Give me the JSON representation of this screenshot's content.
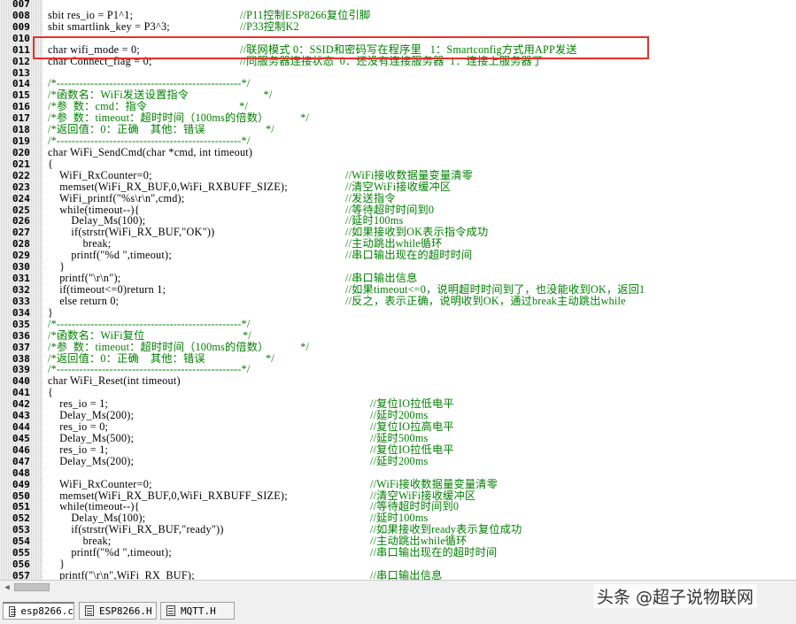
{
  "editor": {
    "lines": [
      {
        "n": "007",
        "code": "",
        "comment": ""
      },
      {
        "n": "008",
        "code": "sbit res_io = P1^1;",
        "comment": "//P11控制ESP8266复位引脚"
      },
      {
        "n": "009",
        "code": "sbit smartlink_key = P3^3;",
        "comment": "//P33控制K2"
      },
      {
        "n": "010",
        "code": "",
        "comment": ""
      },
      {
        "n": "011",
        "code": "char wifi_mode = 0;",
        "comment": "//联网模式 0：SSID和密码写在程序里   1：Smartconfig方式用APP发送"
      },
      {
        "n": "012",
        "code": "char Connect_flag = 0;",
        "comment": "//同服务器连接状态  0：还没有连接服务器  1：连接上服务器了"
      },
      {
        "n": "013",
        "code": "",
        "comment": ""
      },
      {
        "n": "014",
        "code": "",
        "comment": "/*-------------------------------------------------*/"
      },
      {
        "n": "015",
        "code": "",
        "comment": "/*函数名：WiFi发送设置指令                          */"
      },
      {
        "n": "016",
        "code": "",
        "comment": "/*参  数：cmd：指令                                */"
      },
      {
        "n": "017",
        "code": "",
        "comment": "/*参  数：timeout：超时时间（100ms的倍数）           */"
      },
      {
        "n": "018",
        "code": "",
        "comment": "/*返回值：0：正确    其他：错误                     */"
      },
      {
        "n": "019",
        "code": "",
        "comment": "/*-------------------------------------------------*/"
      },
      {
        "n": "020",
        "code": "char WiFi_SendCmd(char *cmd, int timeout)",
        "comment": ""
      },
      {
        "n": "021",
        "code": "{",
        "comment": ""
      },
      {
        "n": "022",
        "code": "    WiFi_RxCounter=0;",
        "comment": "//WiFi接收数据量变量清零"
      },
      {
        "n": "023",
        "code": "    memset(WiFi_RX_BUF,0,WiFi_RXBUFF_SIZE);",
        "comment": "//清空WiFi接收缓冲区"
      },
      {
        "n": "024",
        "code": "    WiFi_printf(\"%s\\r\\n\",cmd);",
        "comment": "//发送指令"
      },
      {
        "n": "025",
        "code": "    while(timeout--){",
        "comment": "//等待超时时间到0"
      },
      {
        "n": "026",
        "code": "        Delay_Ms(100);",
        "comment": "//延时100ms"
      },
      {
        "n": "027",
        "code": "        if(strstr(WiFi_RX_BUF,\"OK\"))",
        "comment": "//如果接收到OK表示指令成功"
      },
      {
        "n": "028",
        "code": "            break;",
        "comment": "//主动跳出while循环"
      },
      {
        "n": "029",
        "code": "        printf(\"%d \",timeout);",
        "comment": "//串口输出现在的超时时间"
      },
      {
        "n": "030",
        "code": "    }",
        "comment": ""
      },
      {
        "n": "031",
        "code": "    printf(\"\\r\\n\");",
        "comment": "//串口输出信息"
      },
      {
        "n": "032",
        "code": "    if(timeout<=0)return 1;",
        "comment": "//如果timeout<=0，说明超时时间到了，也没能收到OK，返回1"
      },
      {
        "n": "033",
        "code": "    else return 0;",
        "comment": "//反之，表示正确，说明收到OK，通过break主动跳出while"
      },
      {
        "n": "034",
        "code": "}",
        "comment": ""
      },
      {
        "n": "035",
        "code": "",
        "comment": "/*-------------------------------------------------*/"
      },
      {
        "n": "036",
        "code": "",
        "comment": "/*函数名：WiFi复位                                  */"
      },
      {
        "n": "037",
        "code": "",
        "comment": "/*参  数：timeout：超时时间（100ms的倍数）           */"
      },
      {
        "n": "038",
        "code": "",
        "comment": "/*返回值：0：正确    其他：错误                     */"
      },
      {
        "n": "039",
        "code": "",
        "comment": "/*-------------------------------------------------*/"
      },
      {
        "n": "040",
        "code": "char WiFi_Reset(int timeout)",
        "comment": ""
      },
      {
        "n": "041",
        "code": "{",
        "comment": ""
      },
      {
        "n": "042",
        "code": "    res_io = 1;",
        "comment": "//复位IO拉低电平"
      },
      {
        "n": "043",
        "code": "    Delay_Ms(200);",
        "comment": "//延时200ms"
      },
      {
        "n": "044",
        "code": "    res_io = 0;",
        "comment": "//复位IO拉高电平"
      },
      {
        "n": "045",
        "code": "    Delay_Ms(500);",
        "comment": "//延时500ms"
      },
      {
        "n": "046",
        "code": "    res_io = 1;",
        "comment": "//复位IO拉低电平"
      },
      {
        "n": "047",
        "code": "    Delay_Ms(200);",
        "comment": "//延时200ms"
      },
      {
        "n": "048",
        "code": "",
        "comment": ""
      },
      {
        "n": "049",
        "code": "    WiFi_RxCounter=0;",
        "comment": "//WiFi接收数据量变量清零"
      },
      {
        "n": "050",
        "code": "    memset(WiFi_RX_BUF,0,WiFi_RXBUFF_SIZE);",
        "comment": "//清空WiFi接收缓冲区"
      },
      {
        "n": "051",
        "code": "    while(timeout--){",
        "comment": "//等待超时时间到0"
      },
      {
        "n": "052",
        "code": "        Delay_Ms(100);",
        "comment": "//延时100ms"
      },
      {
        "n": "053",
        "code": "        if(strstr(WiFi_RX_BUF,\"ready\"))",
        "comment": "//如果接收到ready表示复位成功"
      },
      {
        "n": "054",
        "code": "            break;",
        "comment": "//主动跳出while循环"
      },
      {
        "n": "055",
        "code": "        printf(\"%d \",timeout);",
        "comment": "//串口输出现在的超时时间"
      },
      {
        "n": "056",
        "code": "    }",
        "comment": ""
      },
      {
        "n": "057",
        "code": "    printf(\"\\r\\n\",WiFi_RX_BUF);",
        "comment": "//串口输出信息"
      }
    ]
  },
  "tabs": [
    {
      "label": "esp8266.c",
      "active": true,
      "icon": "c-file-icon"
    },
    {
      "label": "ESP8266.H",
      "active": false,
      "icon": "h-file-icon"
    },
    {
      "label": "MQTT.H",
      "active": false,
      "icon": "h-file-icon"
    }
  ],
  "watermark": "头条 @超子说物联网",
  "colors": {
    "comment": "#008000",
    "code": "#000000",
    "highlight_box": "#e8302a"
  }
}
